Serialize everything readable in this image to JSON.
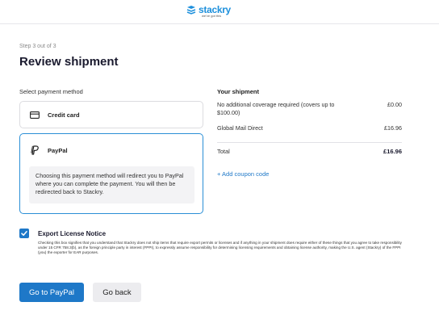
{
  "header": {
    "brand_name": "stackry",
    "brand_tagline": "we've got this",
    "brand_color": "#1e90dc"
  },
  "page": {
    "step": "Step 3 out of 3",
    "title": "Review shipment"
  },
  "payment": {
    "label": "Select payment method",
    "options": [
      {
        "label": "Credit card",
        "icon": "credit-card-icon",
        "selected": false
      },
      {
        "label": "PayPal",
        "icon": "paypal-icon",
        "selected": true
      }
    ],
    "paypal_info": "Choosing this payment method will redirect you to PayPal where you can complete the payment. You will then be redirected back to Stackry."
  },
  "shipment": {
    "title": "Your shipment",
    "rows": [
      {
        "desc": "No additional coverage required (covers up to $100.00)",
        "amount": "£0.00"
      },
      {
        "desc": "Global Mail Direct",
        "amount": "£16.96"
      }
    ],
    "total_label": "Total",
    "total_amount": "£16.96",
    "coupon_link": "+ Add coupon code"
  },
  "export": {
    "checked": true,
    "title": "Export License Notice",
    "text": "Checking this box signifies that you understand that Stackry does not ship items that require export permits or licenses and if anything in your shipment does require either of these things that you agree to take responsibility under 15 CFR 758.3(b), as the foreign principle party in interest (FPPI), to expressly assume responsibility for determining licensing requirements and obtaining license authority, making the U.S. agent (Stackry) of the FPPI (you) the exporter for EAR purposes."
  },
  "actions": {
    "primary": "Go to PayPal",
    "secondary": "Go back",
    "accent_color": "#1e78c8"
  }
}
